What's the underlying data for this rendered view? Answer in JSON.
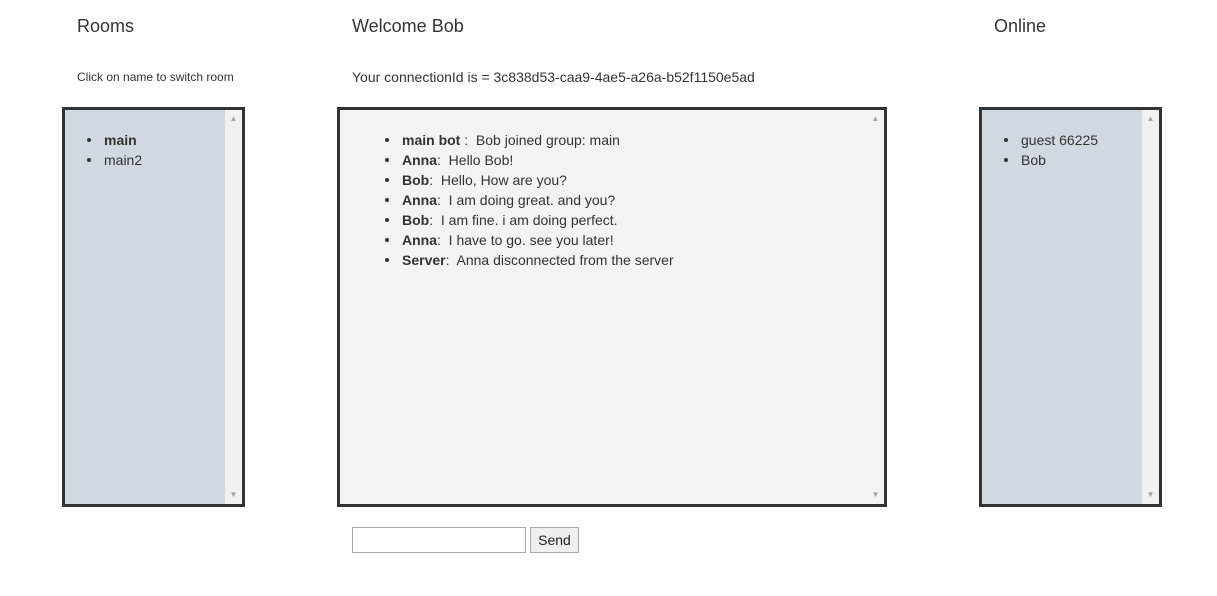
{
  "rooms": {
    "title": "Rooms",
    "hint": "Click on name to switch room",
    "items": [
      {
        "label": "main",
        "active": true
      },
      {
        "label": "main2",
        "active": false
      }
    ]
  },
  "chat": {
    "welcome": "Welcome Bob",
    "connection_text": "Your connectionId is = 3c838d53-caa9-4ae5-a26a-b52f1150e5ad",
    "messages": [
      {
        "sender": "main bot",
        "separator": " : ",
        "text": " Bob joined group: main"
      },
      {
        "sender": "Anna",
        "separator": ": ",
        "text": " Hello Bob!"
      },
      {
        "sender": "Bob",
        "separator": ": ",
        "text": " Hello, How are you?"
      },
      {
        "sender": "Anna",
        "separator": ": ",
        "text": " I am doing great. and you?"
      },
      {
        "sender": "Bob",
        "separator": ": ",
        "text": " I am fine. i am doing perfect."
      },
      {
        "sender": "Anna",
        "separator": ": ",
        "text": " I have to go. see you later!"
      },
      {
        "sender": "Server",
        "separator": ": ",
        "text": " Anna disconnected from the server"
      }
    ],
    "input_value": "",
    "send_label": "Send"
  },
  "online": {
    "title": "Online",
    "users": [
      "guest 66225",
      "Bob"
    ]
  },
  "colors": {
    "side_panel_bg": "#d1d8df",
    "chat_panel_bg": "#f3f3f3",
    "border": "#333333"
  },
  "icons": {
    "scroll_up": "triangle-up-icon",
    "scroll_down": "triangle-down-icon"
  }
}
